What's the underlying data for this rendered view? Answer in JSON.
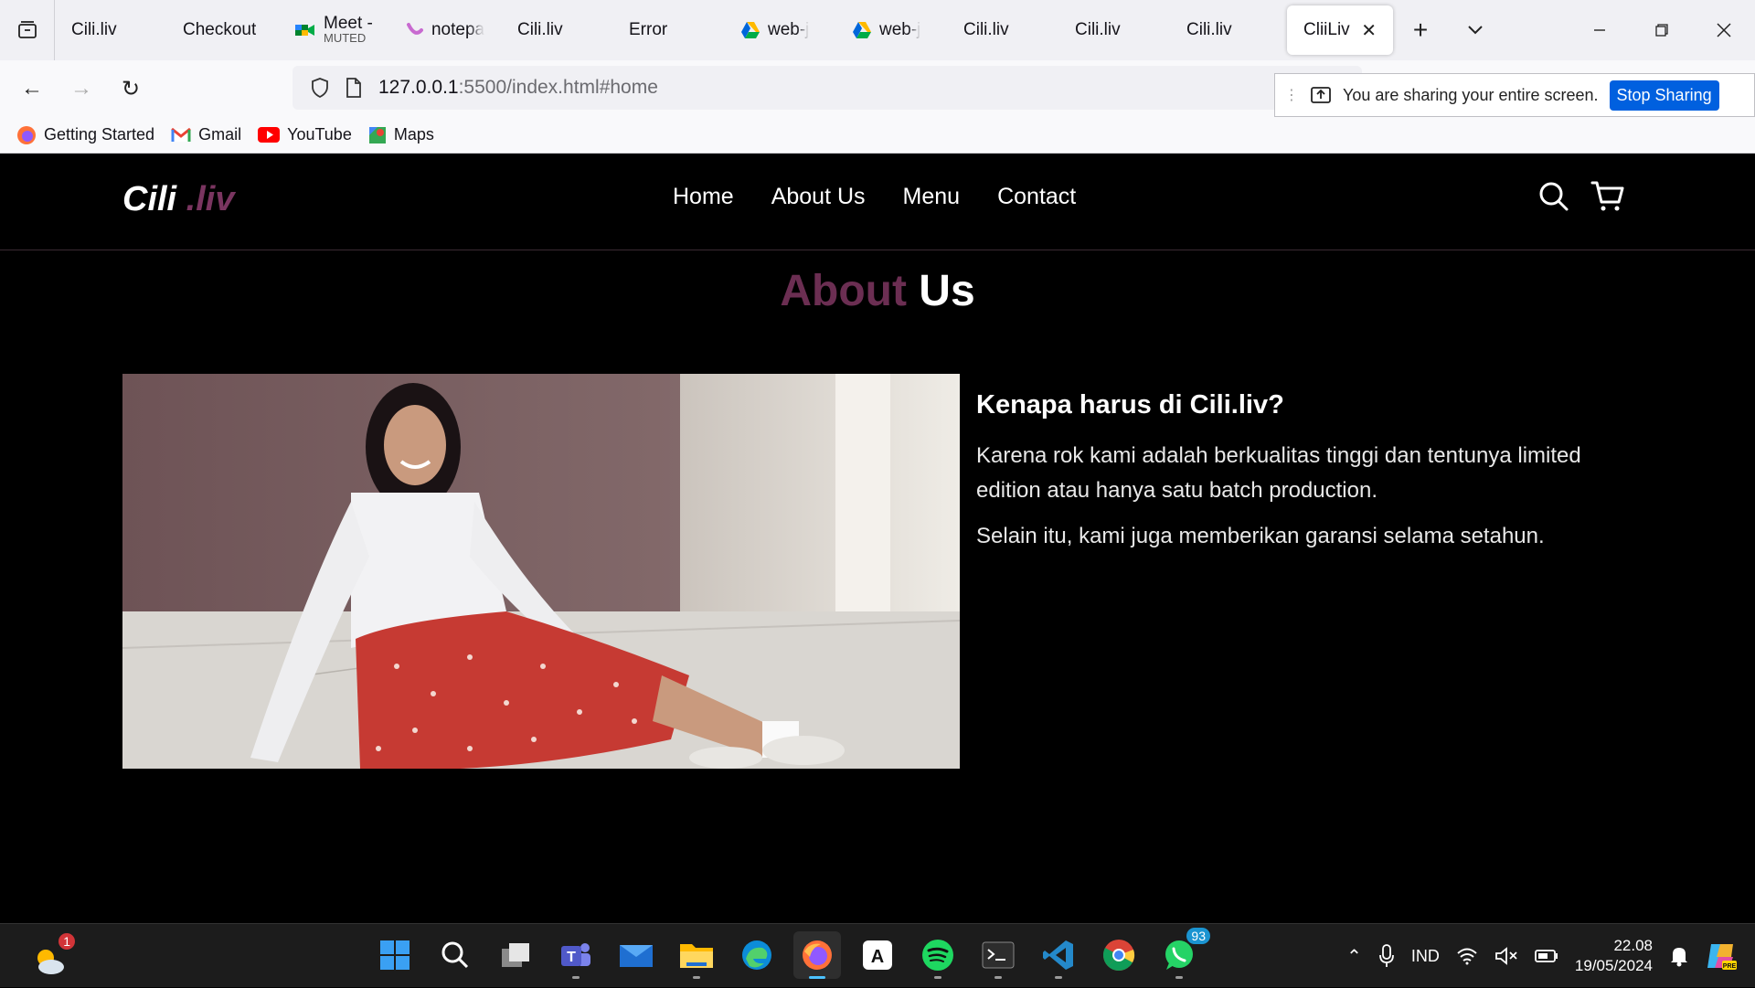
{
  "browser": {
    "tabs": [
      {
        "title": "Cili.liv",
        "icon": "none"
      },
      {
        "title": "Checkout",
        "icon": "none"
      },
      {
        "title": "Meet -",
        "sub": "MUTED",
        "icon": "meet-icon"
      },
      {
        "title": "notepa",
        "icon": "notepad-icon"
      },
      {
        "title": "Cili.liv",
        "icon": "none"
      },
      {
        "title": "Error",
        "icon": "none"
      },
      {
        "title": "web-j",
        "icon": "drive-icon"
      },
      {
        "title": "web-j",
        "icon": "drive-icon"
      },
      {
        "title": "Cili.liv",
        "icon": "none"
      },
      {
        "title": "Cili.liv",
        "icon": "none"
      },
      {
        "title": "Cili.liv",
        "icon": "none"
      }
    ],
    "active_tab": {
      "title": "CliiLiv"
    },
    "url": {
      "host": "127.0.0.1",
      "rest": ":5500/index.html#home"
    },
    "share_bar": {
      "text": "You are sharing your entire screen.",
      "stop_label": "Stop Sharing"
    },
    "bookmarks": [
      {
        "label": "Getting Started",
        "icon": "firefox-icon"
      },
      {
        "label": "Gmail",
        "icon": "gmail-icon"
      },
      {
        "label": "YouTube",
        "icon": "youtube-icon"
      },
      {
        "label": "Maps",
        "icon": "maps-icon"
      }
    ]
  },
  "site": {
    "logo": {
      "main": "Cili",
      "accent": " .liv"
    },
    "menu": [
      "Home",
      "About Us",
      "Menu",
      "Contact"
    ],
    "about": {
      "title_accent": "About",
      "title_rest": " Us",
      "heading": "Kenapa harus di Cili.liv?",
      "para1": "Karena rok kami adalah berkualitas tinggi dan tentunya limited edition atau hanya satu batch production.",
      "para2": "Selain itu, kami juga memberikan garansi selama setahun."
    },
    "colors": {
      "accent": "#7a3560",
      "background": "#000000"
    }
  },
  "taskbar": {
    "weather_badge": "1",
    "whatsapp_badge": "93",
    "language": "IND",
    "time": "22.08",
    "date": "19/05/2024"
  }
}
